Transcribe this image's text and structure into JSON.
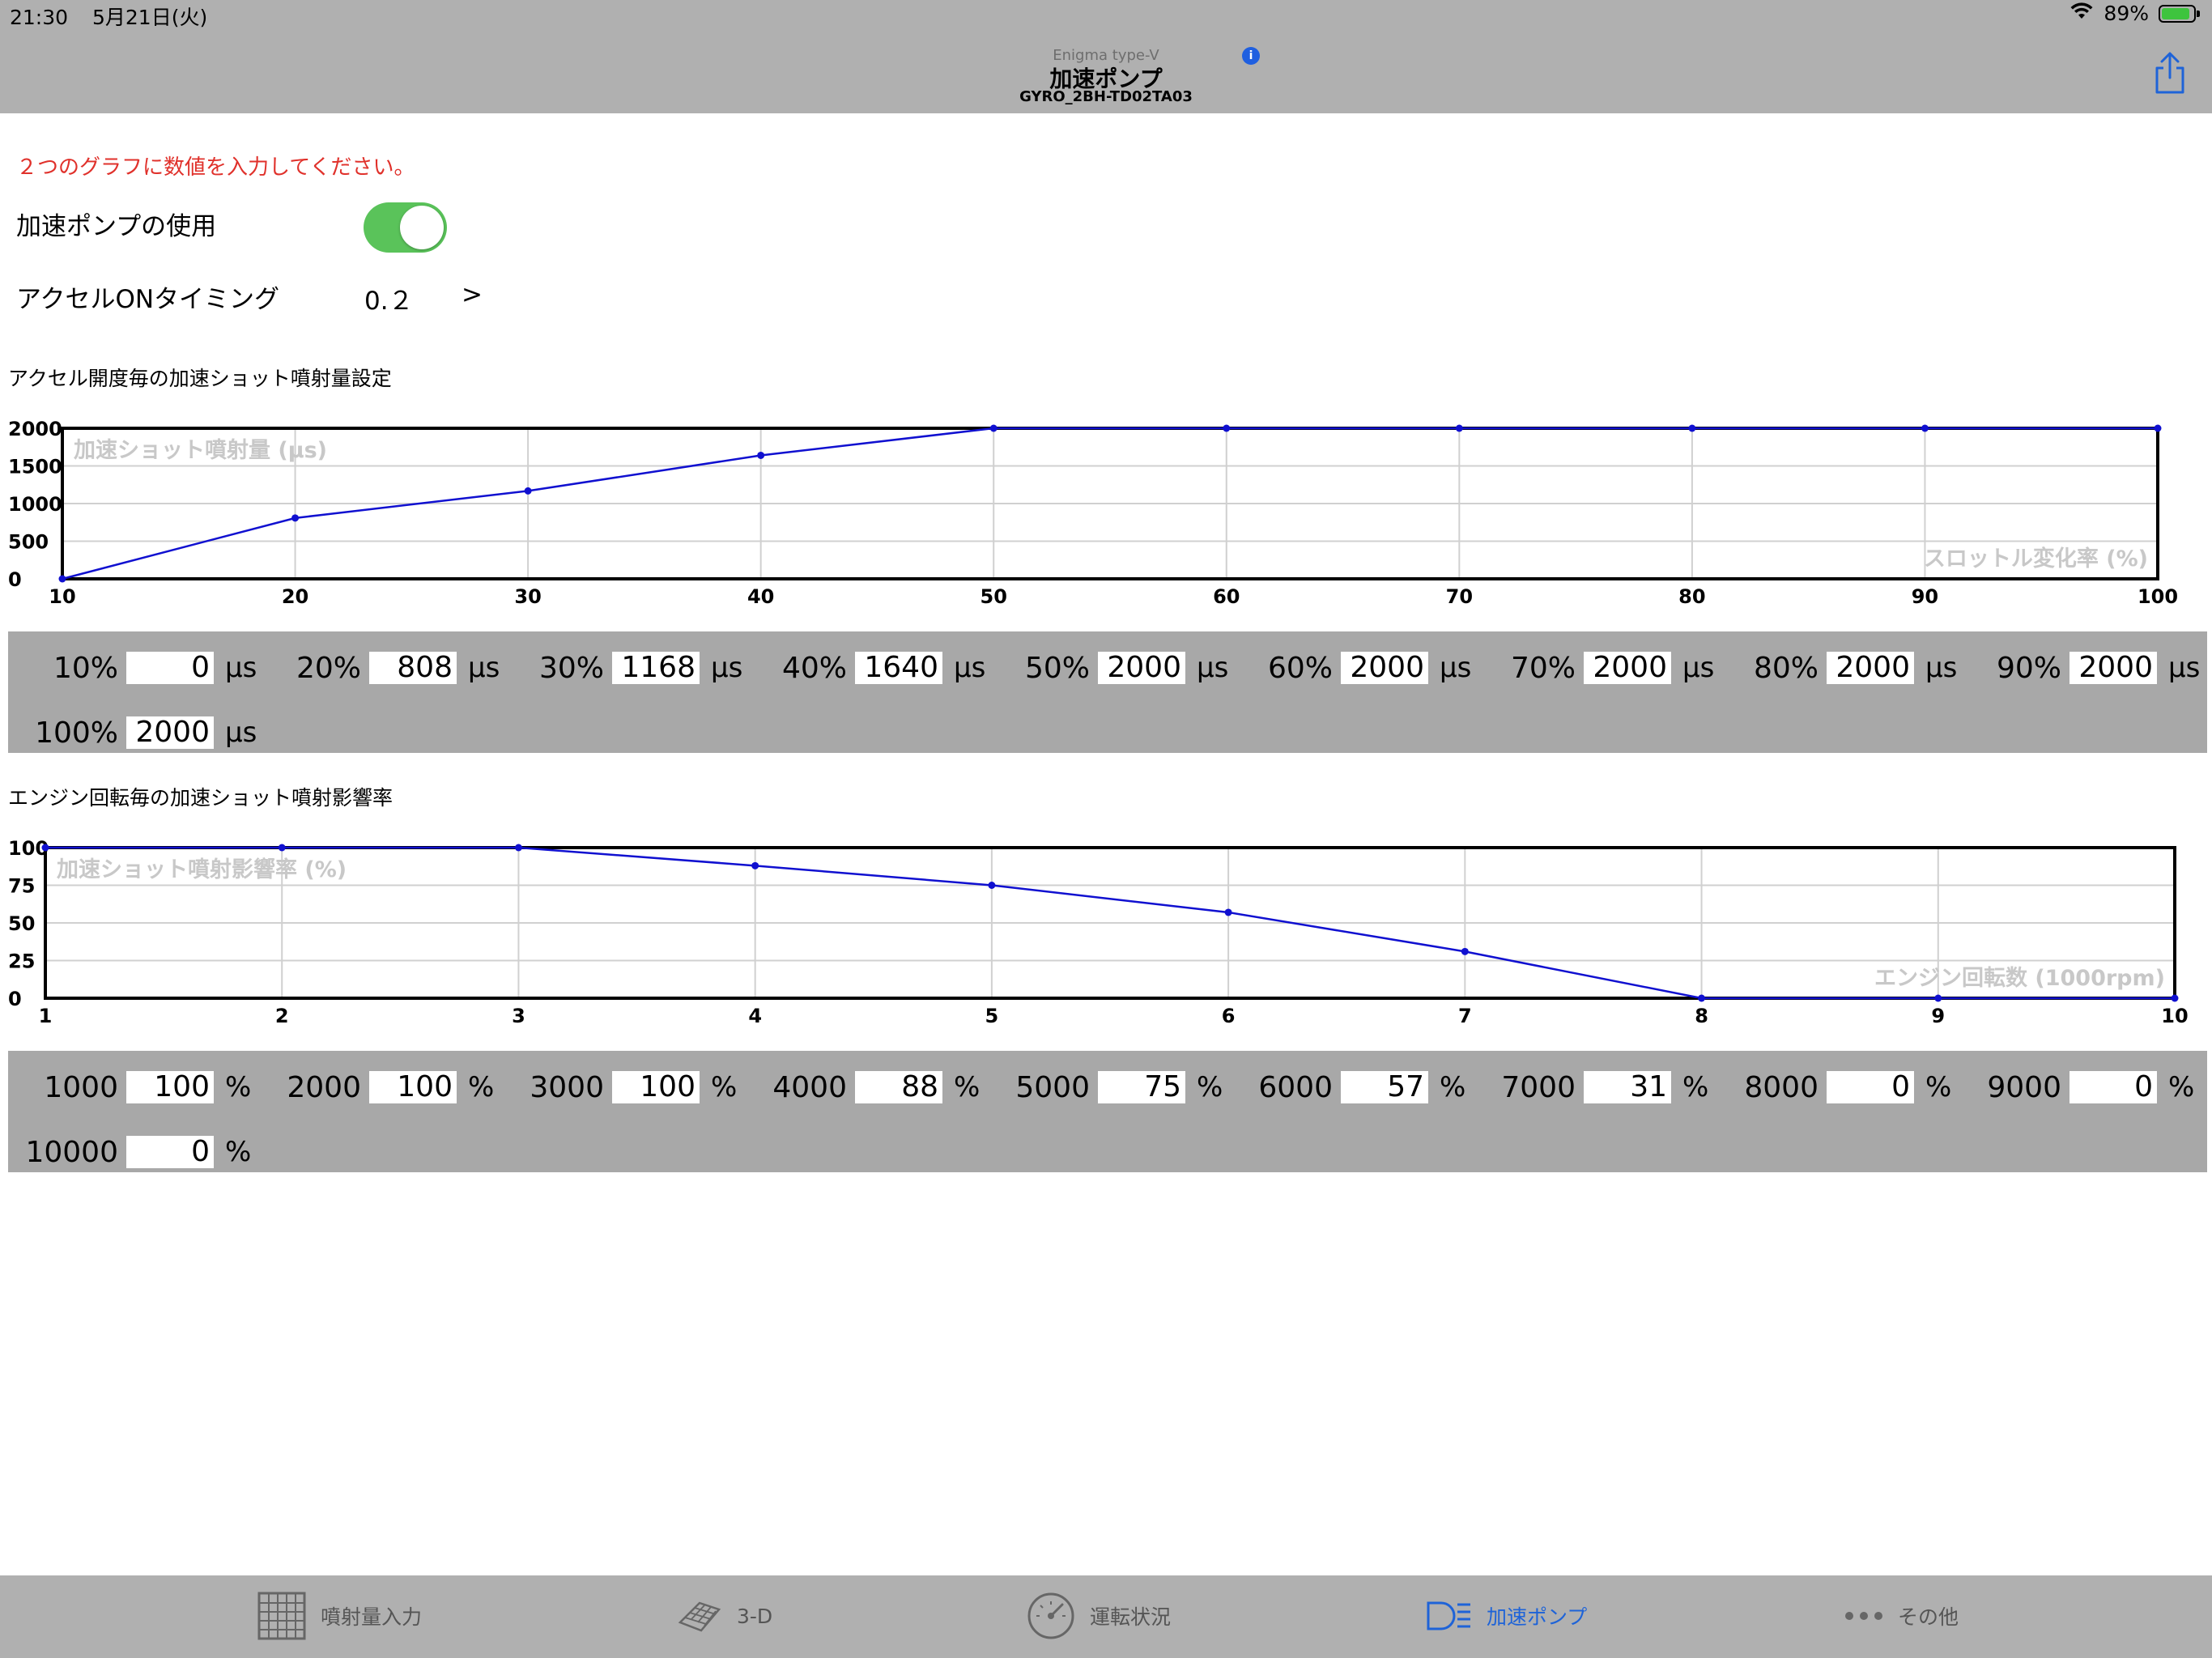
{
  "status_bar": {
    "time": "21:30",
    "date": "5月21日(火)",
    "battery": "89%",
    "battery_level": 0.89
  },
  "nav": {
    "subtitle": "Enigma type-V",
    "title": "加速ポンプ",
    "model": "GYRO_2BH-TD02TA03"
  },
  "instruction": "２つのグラフに数値を入力してください。",
  "pump_use": {
    "label": "加速ポンプの使用",
    "on": true
  },
  "accel_timing": {
    "label": "アクセルONタイミング",
    "value": "0.２",
    "chevron": ">"
  },
  "section1": {
    "title": "アクセル開度毎の加速ショット噴射量設定"
  },
  "section2": {
    "title": "エンジン回転毎の加速ショット噴射影響率"
  },
  "chart_data": [
    {
      "type": "line",
      "x": [
        10,
        20,
        30,
        40,
        50,
        60,
        70,
        80,
        90,
        100
      ],
      "series": [
        {
          "values": [
            0,
            808,
            1168,
            1640,
            2000,
            2000,
            2000,
            2000,
            2000,
            2000
          ]
        }
      ],
      "xlim": [
        10,
        100
      ],
      "ylim": [
        0,
        2000
      ],
      "x_ticks": [
        "10",
        "20",
        "30",
        "40",
        "50",
        "60",
        "70",
        "80",
        "90",
        "100"
      ],
      "y_ticks": [
        "2000",
        "1500",
        "1000",
        "500",
        "0"
      ],
      "ylabel": "加速ショット噴射量 (µs)",
      "xlabel": "スロットル変化率 (%)",
      "line_color": "#1010d0",
      "grid": true
    },
    {
      "type": "line",
      "x": [
        1,
        2,
        3,
        4,
        5,
        6,
        7,
        8,
        9,
        10
      ],
      "series": [
        {
          "values": [
            100,
            100,
            100,
            88,
            75,
            57,
            31,
            0,
            0,
            0
          ]
        }
      ],
      "xlim": [
        1,
        10
      ],
      "ylim": [
        0,
        100
      ],
      "x_ticks": [
        "1",
        "2",
        "3",
        "4",
        "5",
        "6",
        "7",
        "8",
        "9",
        "10"
      ],
      "y_ticks": [
        "100",
        "75",
        "50",
        "25",
        "0"
      ],
      "ylabel": "加速ショット噴射影響率 (%)",
      "xlabel": "エンジン回転数 (1000rpm)",
      "line_color": "#1010d0",
      "grid": true
    }
  ],
  "throttle_inputs": [
    {
      "label": "10%",
      "value": "0",
      "unit": "µs"
    },
    {
      "label": "20%",
      "value": "808",
      "unit": "µs"
    },
    {
      "label": "30%",
      "value": "1168",
      "unit": "µs"
    },
    {
      "label": "40%",
      "value": "1640",
      "unit": "µs"
    },
    {
      "label": "50%",
      "value": "2000",
      "unit": "µs"
    },
    {
      "label": "60%",
      "value": "2000",
      "unit": "µs"
    },
    {
      "label": "70%",
      "value": "2000",
      "unit": "µs"
    },
    {
      "label": "80%",
      "value": "2000",
      "unit": "µs"
    },
    {
      "label": "90%",
      "value": "2000",
      "unit": "µs"
    },
    {
      "label": "100%",
      "value": "2000",
      "unit": "µs"
    }
  ],
  "rpm_inputs": [
    {
      "label": "1000",
      "value": "100",
      "unit": "%"
    },
    {
      "label": "2000",
      "value": "100",
      "unit": "%"
    },
    {
      "label": "3000",
      "value": "100",
      "unit": "%"
    },
    {
      "label": "4000",
      "value": "88",
      "unit": "%"
    },
    {
      "label": "5000",
      "value": "75",
      "unit": "%"
    },
    {
      "label": "6000",
      "value": "57",
      "unit": "%"
    },
    {
      "label": "7000",
      "value": "31",
      "unit": "%"
    },
    {
      "label": "8000",
      "value": "0",
      "unit": "%"
    },
    {
      "label": "9000",
      "value": "0",
      "unit": "%"
    },
    {
      "label": "10000",
      "value": "0",
      "unit": "%"
    }
  ],
  "tabs": [
    {
      "label": "噴射量入力",
      "icon": "grid-table-icon",
      "active": false
    },
    {
      "label": "3-D",
      "icon": "3d-mesh-icon",
      "active": false
    },
    {
      "label": "運転状況",
      "icon": "speedometer-icon",
      "active": false
    },
    {
      "label": "加速ポンプ",
      "icon": "headlight-icon",
      "active": true
    },
    {
      "label": "その他",
      "icon": "ellipsis-icon",
      "active": false
    }
  ],
  "colors": {
    "accent": "#1e63d8",
    "toggle_on": "#5ac35a",
    "warning_text": "#e0312b",
    "bar_gray": "#b0b0b0",
    "panel_gray": "#a8a8a8"
  }
}
